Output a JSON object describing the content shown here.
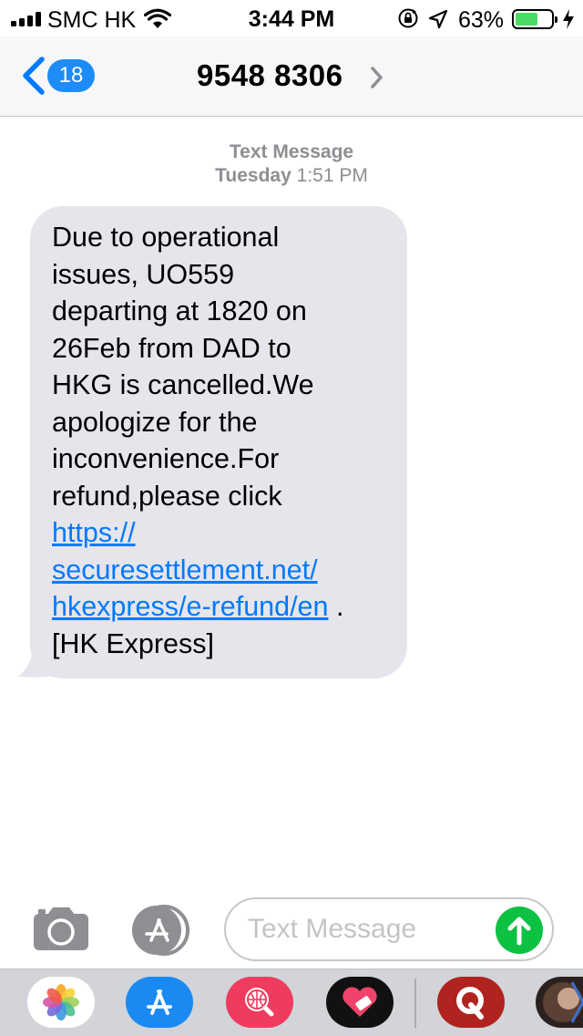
{
  "status_bar": {
    "carrier": "SMC HK",
    "time": "3:44 PM",
    "battery_percent": "63%",
    "battery_level": 0.63,
    "signal_bars": 4
  },
  "nav": {
    "back_badge": "18",
    "contact": "9548 8306"
  },
  "conversation": {
    "label": "Text Message",
    "date_day": "Tuesday",
    "date_time": "1:51 PM",
    "message": {
      "lines": [
        "Due to operational",
        "issues, UO559",
        "departing at 1820 on",
        "26Feb from DAD to",
        "HKG is cancelled.We",
        "apologize for the",
        "inconvenience.For",
        "refund,please click"
      ],
      "link_lines": [
        "https://",
        "securesettlement.net/",
        "hkexpress/e-refund/en"
      ],
      "after_link": " .",
      "signature": "[HK Express]"
    }
  },
  "compose": {
    "placeholder": "Text Message"
  },
  "drawer_apps": [
    {
      "name": "Photos",
      "icon": "photos-icon"
    },
    {
      "name": "App Store",
      "icon": "app-store-icon"
    },
    {
      "name": "Search",
      "icon": "globe-search-icon"
    },
    {
      "name": "Heart",
      "icon": "heart-icon"
    },
    {
      "name": "Quora",
      "icon": "quora-icon"
    },
    {
      "name": "Partial",
      "icon": "partial-app-icon"
    }
  ],
  "colors": {
    "accent": "#007aff",
    "badge": "#1d8cf8",
    "bubble": "#e6e5eb",
    "send": "#0dc142",
    "battery": "#4cd964"
  }
}
